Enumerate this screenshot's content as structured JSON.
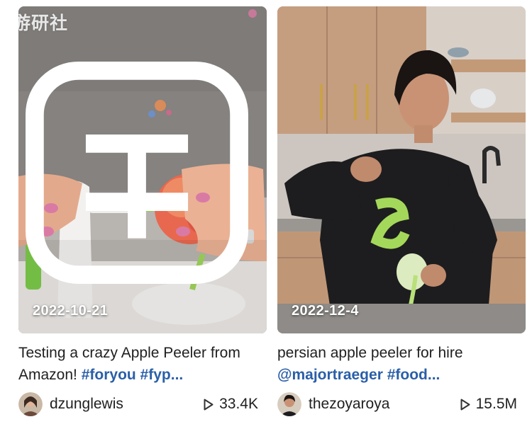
{
  "watermark": {
    "text": "游研社",
    "icon": "site-logo-icon"
  },
  "cards": [
    {
      "date": "2022-10-21",
      "caption_text": "Testing a crazy Apple Peeler from Amazon! ",
      "caption_tags": "#foryou #fyp...",
      "author": "dzunglewis",
      "views": "33.4K",
      "icon": "play-icon"
    },
    {
      "date": "2022-12-4",
      "caption_text": "persian apple peeler for hire ",
      "caption_tags": "@majortraeger #food...",
      "author": "thezoyaroya",
      "views": "15.5M",
      "icon": "play-icon"
    }
  ],
  "colors": {
    "tag": "#2a5fa8",
    "text": "#1f1f1f",
    "background": "#ffffff"
  }
}
